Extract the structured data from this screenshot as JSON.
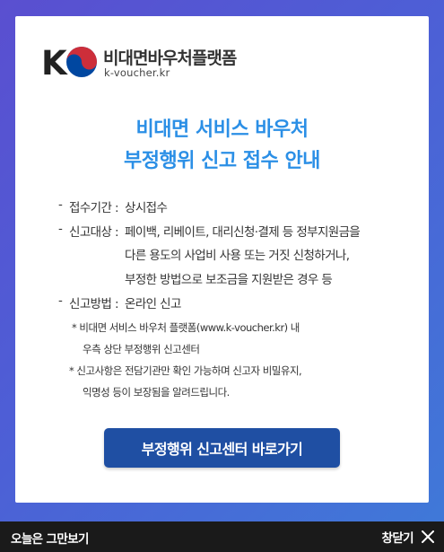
{
  "logo": {
    "mark_letter": "K",
    "name": "비대면바우처플랫폼",
    "url": "k-voucher.kr"
  },
  "title": {
    "line1": "비대면 서비스 바우처",
    "line2": "부정행위 신고 접수 안내"
  },
  "info": {
    "rows": [
      {
        "dash": "-",
        "label": "접수기간 :",
        "value": "상시접수"
      },
      {
        "dash": "-",
        "label": "신고대상 :",
        "value": "페이백, 리베이트, 대리신청·결제 등 정부지원금을"
      },
      {
        "dash": "-",
        "label": "신고방법 :",
        "value": "온라인 신고"
      }
    ],
    "continuation": [
      "다른 용도의 사업비 사용 또는 거짓 신청하거나,",
      "부정한 방법으로 보조금을 지원받은 경우 등"
    ],
    "notes": [
      "* 비대면 서비스 바우처 플랫폼(www.k-voucher.kr) 내",
      "우측 상단 부정행위 신고센터",
      "* 신고사항은 전담기관만 확인 가능하며 신고자 비밀유지,",
      "익명성 등이 보장됨을 알려드립니다."
    ]
  },
  "cta_label": "부정행위 신고센터 바로가기",
  "bottom_bar": {
    "dont_show_label": "오늘은 그만보기",
    "close_label": "창닫기",
    "close_icon": "close-icon"
  },
  "colors": {
    "title": "#2b8fe6",
    "cta_bg": "#1f4fa3",
    "bottom_bg": "#1a1a1a",
    "logo_red": "#cd2e3a",
    "logo_blue": "#0047a0"
  }
}
